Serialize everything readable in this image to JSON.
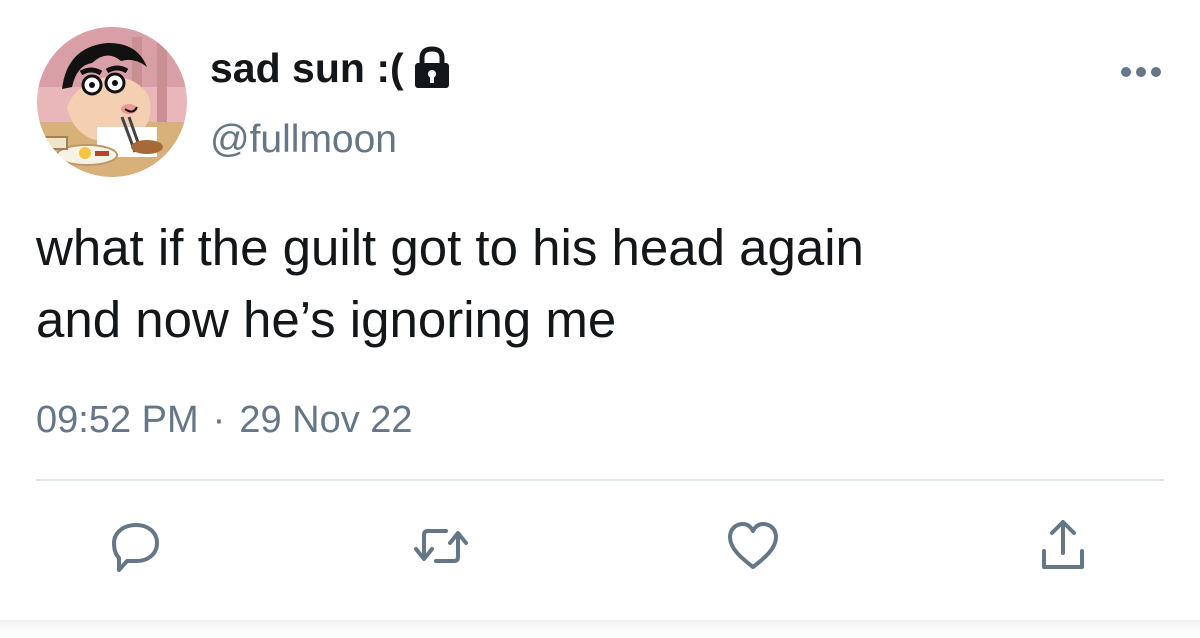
{
  "user": {
    "display_name": "sad sun :(",
    "handle": "@fullmoon",
    "protected": true
  },
  "tweet": {
    "text": "what if the guilt got to his head again\nand now he’s ignoring me",
    "time": "09:52 PM",
    "separator": "·",
    "date": "29 Nov 22"
  },
  "icons": {
    "avatar": "cartoon-boy-eating-avatar",
    "lock": "lock-icon",
    "more": "more-horizontal-icon",
    "reply": "reply-icon",
    "retweet": "retweet-icon",
    "like": "heart-icon",
    "share": "share-icon"
  },
  "colors": {
    "text": "#14171a",
    "secondary": "#657786",
    "icon": "#657786",
    "divider": "#e1e8ed"
  }
}
